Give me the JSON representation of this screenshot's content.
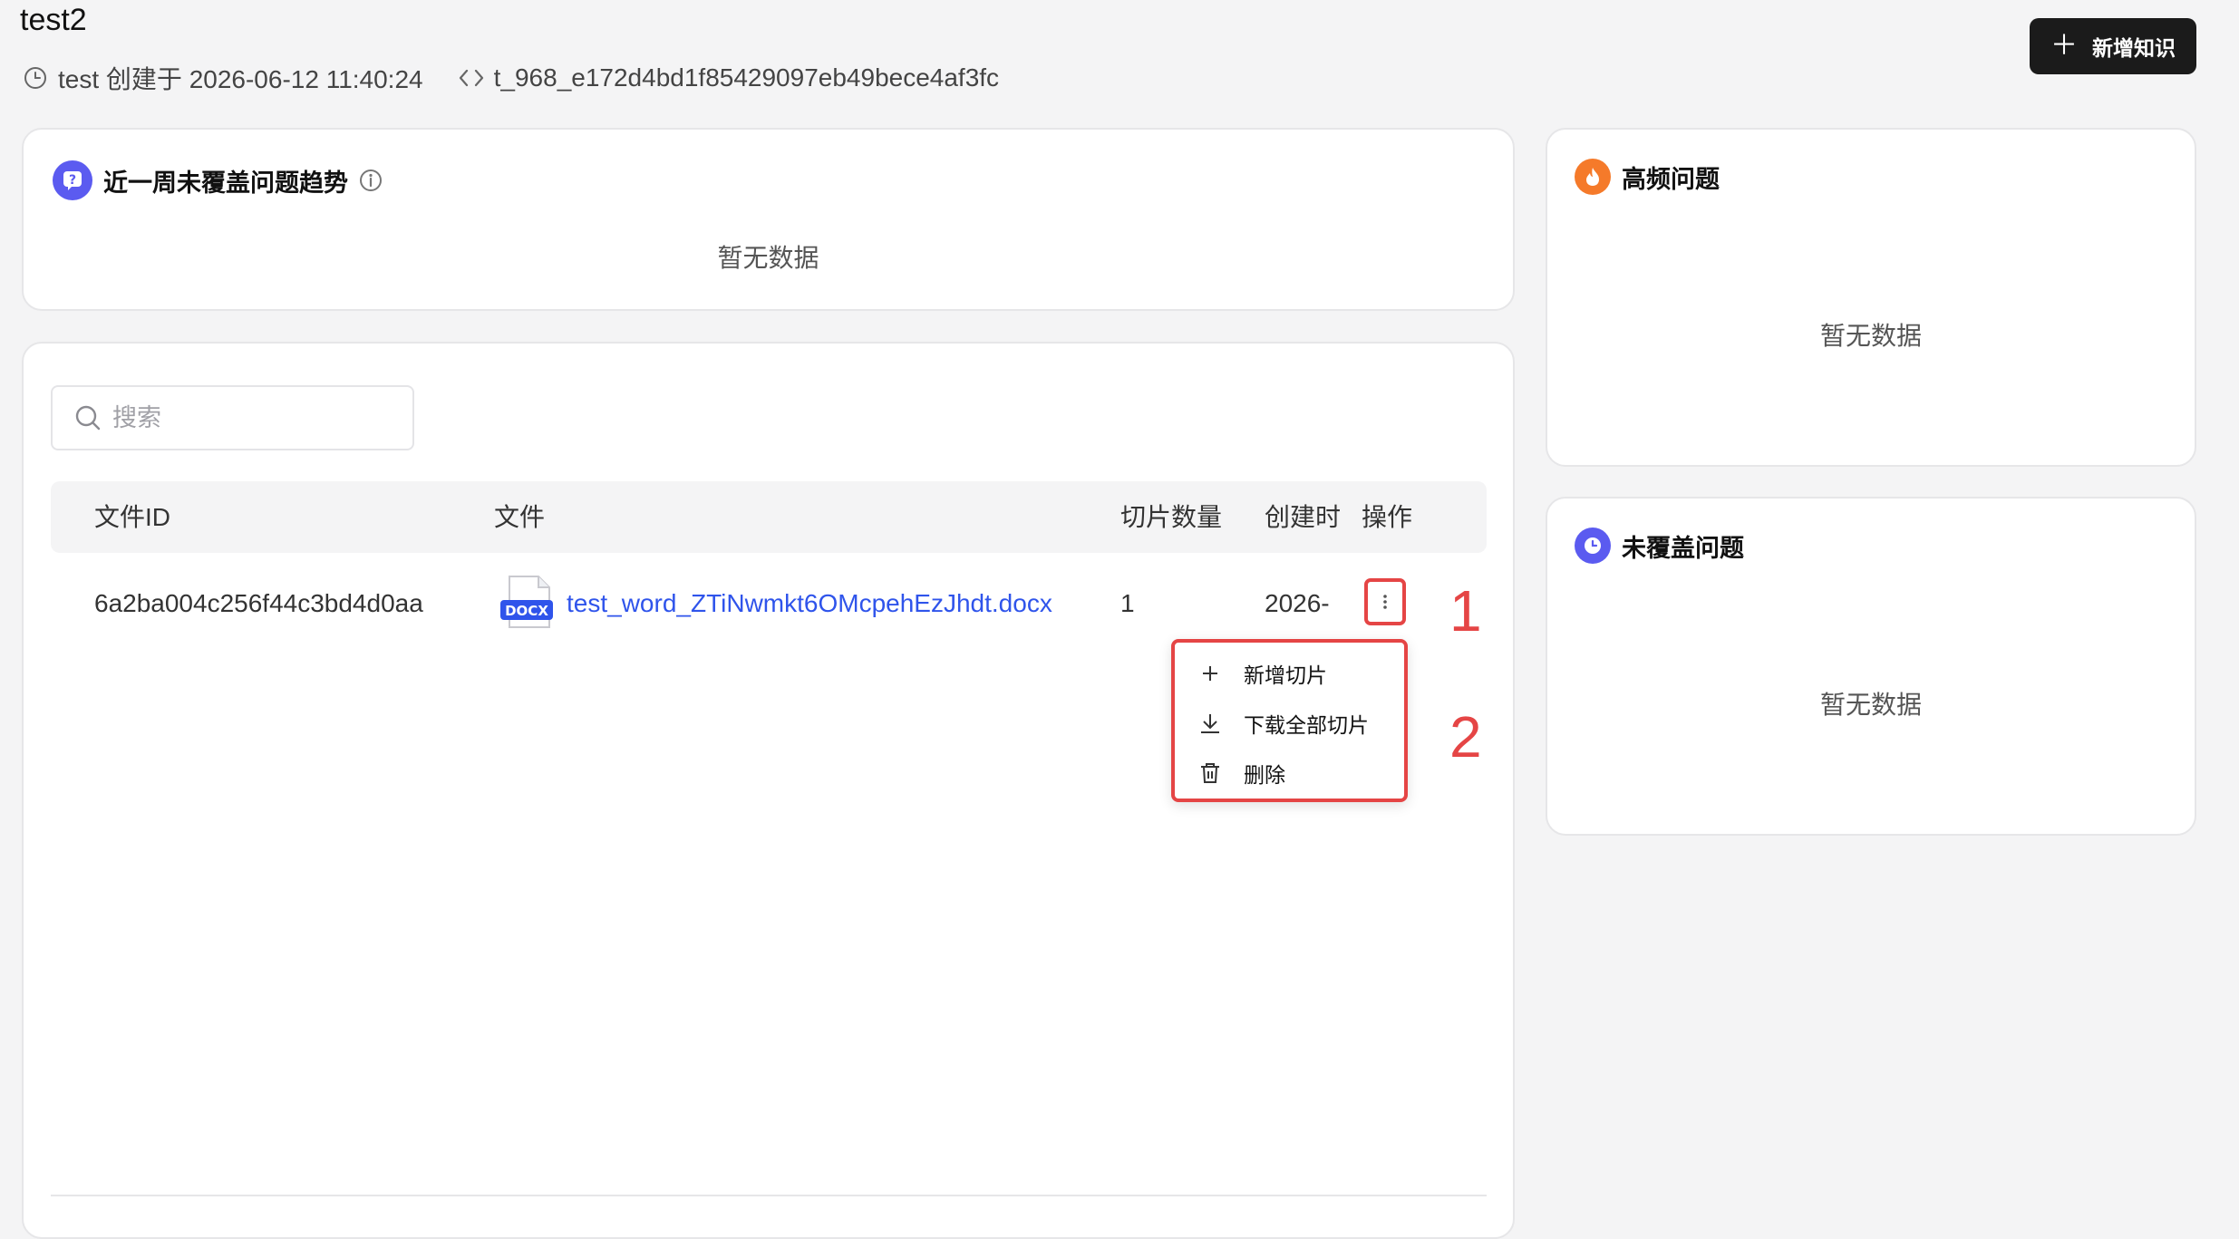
{
  "header": {
    "title": "test2",
    "meta_creator": "test 创建于 2026-06-12 11:40:24",
    "meta_id": "t_968_e172d4bd1f85429097eb49bece4af3fc",
    "add_button_label": "新增知识"
  },
  "trend_card": {
    "title": "近一周未覆盖问题趋势",
    "empty_text": "暂无数据"
  },
  "search": {
    "placeholder": "搜索"
  },
  "table": {
    "columns": [
      "文件ID",
      "文件",
      "切片数量",
      "创建时",
      "操作"
    ],
    "rows": [
      {
        "file_id": "6a2ba004c256f44c3bd4d0aa",
        "file_type": "DOCX",
        "file_name": "test_word_ZTiNwmkt6OMcpehEzJhdt.docx",
        "slice_count": "1",
        "created": "2026-"
      }
    ]
  },
  "dropdown_menu": {
    "items": [
      {
        "label": "新增切片",
        "icon": "plus-icon"
      },
      {
        "label": "下载全部切片",
        "icon": "download-icon"
      },
      {
        "label": "删除",
        "icon": "trash-icon"
      }
    ]
  },
  "annotations": {
    "marker_1": "1",
    "marker_2": "2"
  },
  "high_freq_card": {
    "title": "高频问题",
    "empty_text": "暂无数据"
  },
  "uncovered_card": {
    "title": "未覆盖问题",
    "empty_text": "暂无数据"
  },
  "colors": {
    "accent_purple": "#5b5bf0",
    "accent_orange": "#f57a2a",
    "link_blue": "#2f54eb",
    "annotation_red": "#e54545",
    "primary_button": "#1b1b1b"
  }
}
